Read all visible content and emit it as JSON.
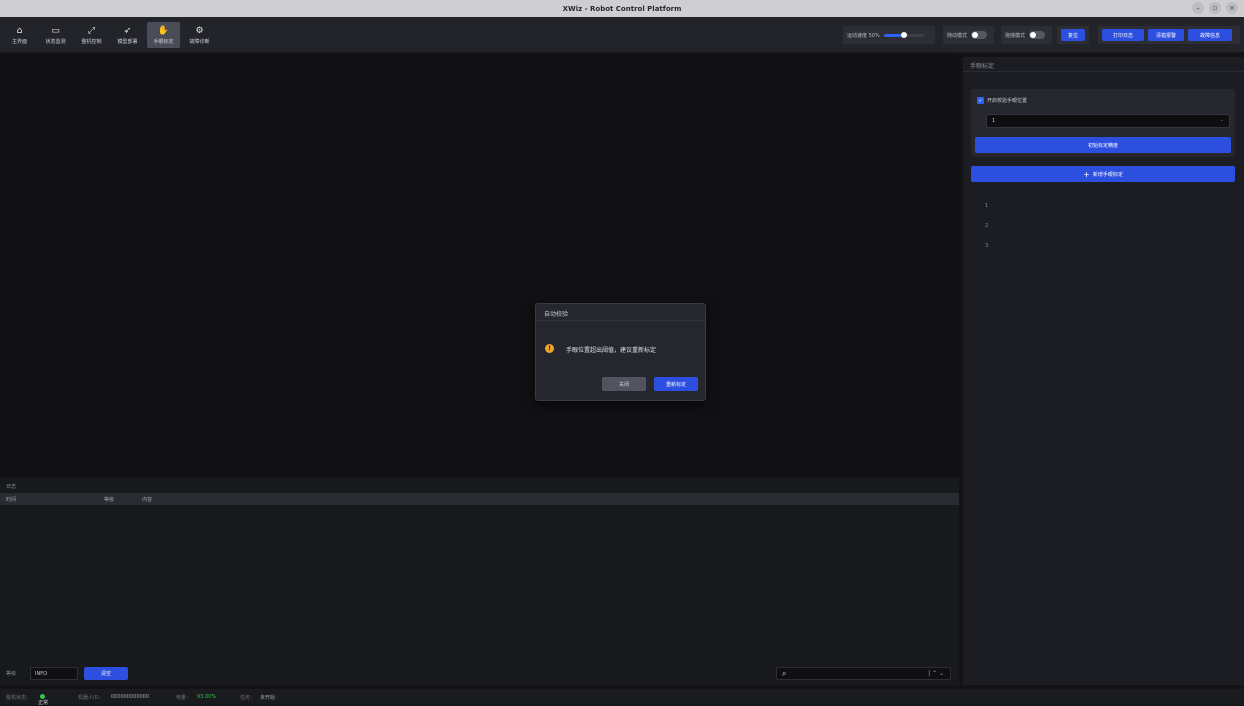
{
  "window": {
    "title": "XWiz - Robot Control Platform"
  },
  "nav": [
    {
      "label": "主界面",
      "icon": "home-icon",
      "glyph": "⌂"
    },
    {
      "label": "状态监测",
      "icon": "monitor-icon",
      "glyph": "▭"
    },
    {
      "label": "整机控制",
      "icon": "robot-arm-icon",
      "glyph": "⤢"
    },
    {
      "label": "模型部署",
      "icon": "rocket-icon",
      "glyph": "➶"
    },
    {
      "label": "手眼标定",
      "icon": "hand-eye-icon",
      "glyph": "✋"
    },
    {
      "label": "故障诊断",
      "icon": "diagnosis-icon",
      "glyph": "⚙"
    }
  ],
  "toolbar": {
    "speed_label": "运动速度 50%",
    "speed_level": 0.5,
    "follow_mode": "随动模式",
    "drag_mode": "拖拽模式",
    "reset": "复位",
    "print_log": "打印日志",
    "clear_fault": "清错报警",
    "fault_info": "故障信息"
  },
  "right_panel": {
    "title": "手眼标定",
    "checkbox_label": "开启校验手眼位置",
    "select_value": "1",
    "calibrate_button": "初始标定精度",
    "add_button": "新增手眼标定",
    "list": [
      "1",
      "2",
      "3"
    ]
  },
  "log": {
    "title": "日志",
    "columns": [
      "时间",
      "等级",
      "内容"
    ],
    "level_label": "等级",
    "level_value": "INFO",
    "clear_button": "清空"
  },
  "status": {
    "machine_label": "整机状态：",
    "machine_value": "正常",
    "robot_label": "机器人ID：",
    "robot_value": "000000000000",
    "battery_label": "电量：",
    "battery_value": "93.00%",
    "task_label": "任务：",
    "task_value": "未开始"
  },
  "modal": {
    "title": "自动校验",
    "message": "手眼位置超出阈值，建议重新标定",
    "close": "关闭",
    "recalibrate": "重新标定"
  },
  "colors": {
    "accent": "#2d4fe0",
    "warning": "#f0a52a",
    "ok": "#33c24d"
  }
}
